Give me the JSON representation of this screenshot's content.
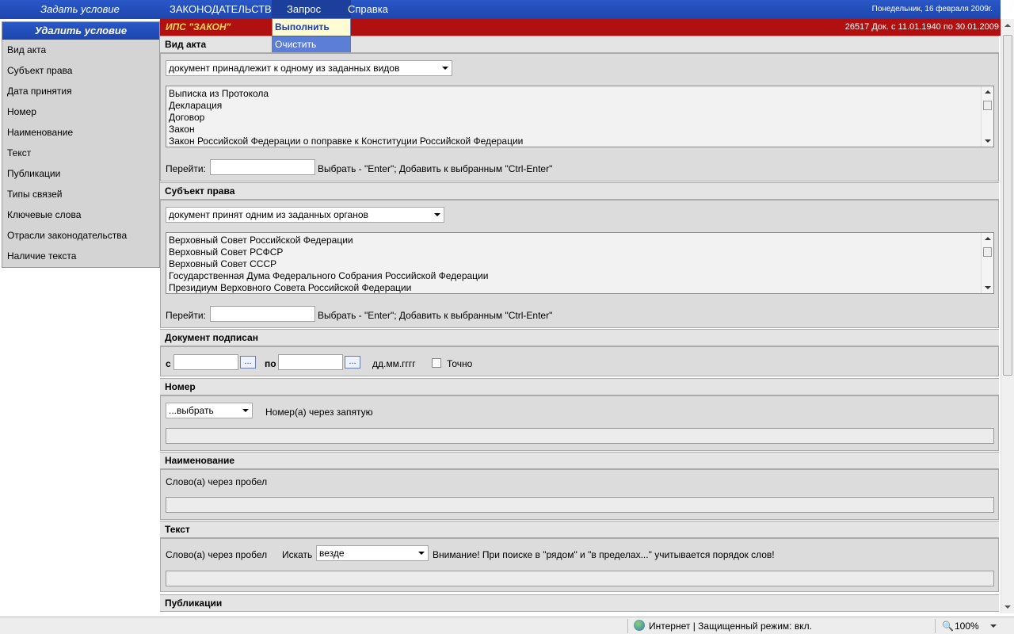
{
  "topbar": {
    "set_condition": "Задать условие",
    "menus": [
      "ЗАКОНОДАТЕЛЬСТВО",
      "Запрос",
      "Справка"
    ],
    "date": "Понедельник, 16 февраля 2009г."
  },
  "redbar": {
    "title": "ИПС \"ЗАКОН\"",
    "docs_info": "26517 Док. с 11.01.1940 по 30.01.2009"
  },
  "dropdown": {
    "items": [
      "Выполнить",
      "Очистить"
    ]
  },
  "sidebar": {
    "delete_condition": "Удалить условие",
    "items": [
      "Вид акта",
      "Субъект права",
      "Дата принятия",
      "Номер",
      "Наименование",
      "Текст",
      "Публикации",
      "Типы связей",
      "Ключевые слова",
      "Отрасли законодательства",
      "Наличие текста"
    ]
  },
  "sections": {
    "act_type": {
      "title": "Вид акта",
      "mode": "документ принадлежит к одному из заданных видов",
      "list": [
        "Выписка из Протокола",
        "Декларация",
        "Договор",
        "Закон",
        "Закон Российской Федерации о поправке к Конституции Российской Федерации"
      ],
      "goto_label": "Перейти:",
      "hint": "Выбрать - \"Enter\"; Добавить к выбранным \"Ctrl-Enter\""
    },
    "subject": {
      "title": "Субъект права",
      "mode": "документ принят одним из заданных органов",
      "list": [
        "Верховный Совет Российской Федерации",
        "Верховный Совет РСФСР",
        "Верховный Совет СССР",
        "Государственная Дума Федерального Собрания Российской Федерации",
        "Президиум Верховного Совета Российской Федерации"
      ],
      "goto_label": "Перейти:",
      "hint": "Выбрать - \"Enter\"; Добавить к выбранным \"Ctrl-Enter\""
    },
    "signed": {
      "title": "Документ подписан",
      "from_label": "с",
      "to_label": "по",
      "dots": "...",
      "format": "дд.мм.гггг",
      "exact_label": "Точно"
    },
    "number": {
      "title": "Номер",
      "select": "...выбрать",
      "hint": "Номер(а) через запятую"
    },
    "name": {
      "title": "Наименование",
      "hint": "Слово(а) через пробел"
    },
    "text": {
      "title": "Текст",
      "hint": "Слово(а) через пробел",
      "search_label": "Искать",
      "search_value": "везде",
      "warning": "Внимание! При поиске в \"рядом\" и \"в пределах...\" учитывается порядок слов!"
    },
    "publications": {
      "title": "Публикации"
    }
  },
  "status": {
    "zone": "Интернет | Защищенный режим: вкл.",
    "zoom": "100%"
  }
}
